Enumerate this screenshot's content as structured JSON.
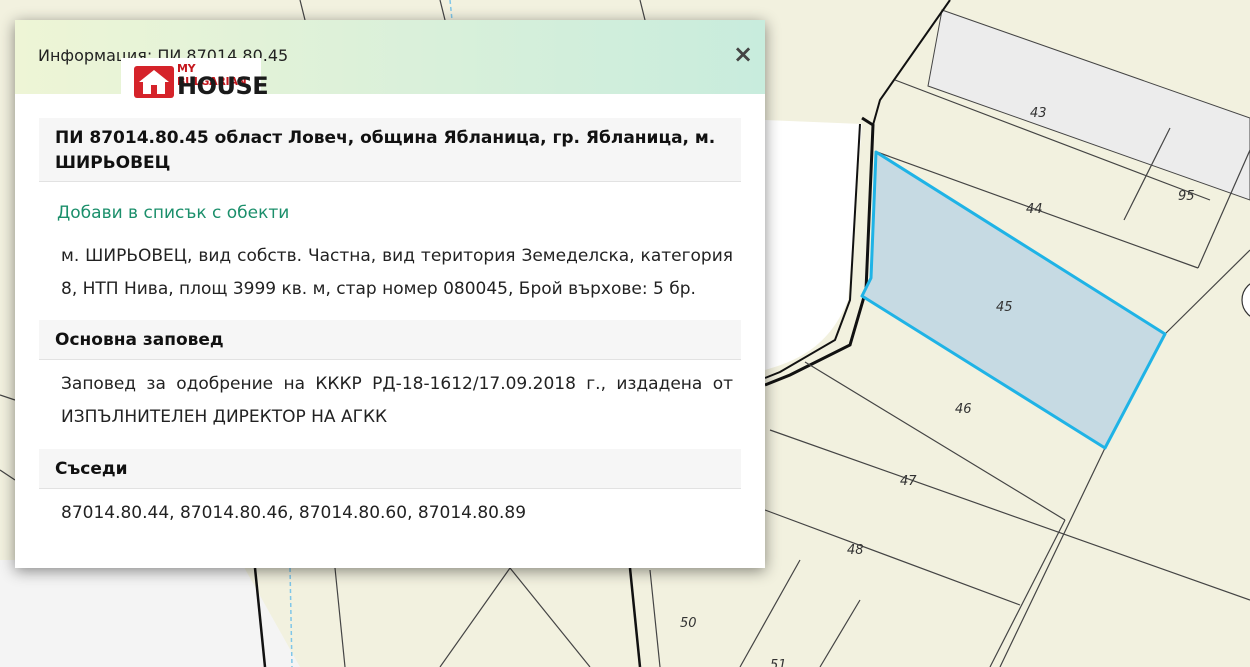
{
  "map": {
    "parcel_labels": [
      "43",
      "44",
      "95",
      "45",
      "46",
      "47",
      "48",
      "50",
      "51"
    ],
    "colors": {
      "background": "#f2f1df",
      "road": "#ececec",
      "selected_fill": "#c6dae3",
      "selected_stroke": "#1fb3e6"
    }
  },
  "popup": {
    "title": "Информация: ПИ 87014.80.45",
    "close_label": "×",
    "logo": {
      "small_text": "MY BULGARIAN",
      "big_text": "HOUSE"
    },
    "parcel_heading": "ПИ 87014.80.45 област Ловеч, община Ябланица, гр. Ябланица, м. ШИРЬОВЕЦ",
    "add_link": "Добави в списък с обекти",
    "description": "м. ШИРЬОВЕЦ, вид собств. Частна, вид територия Земеделска, категория 8, НТП Нива, площ 3999 кв. м, стар номер 080045, Брой върхове: 5 бр.",
    "order_heading": "Основна заповед",
    "order_text": "Заповед за одобрение на КККР РД-18-1612/17.09.2018 г., издадена от ИЗПЪЛНИТЕЛЕН ДИРЕКТОР НА АГКК",
    "neighbors_heading": "Съседи",
    "neighbors_text": "87014.80.44, 87014.80.46, 87014.80.60, 87014.80.89"
  }
}
